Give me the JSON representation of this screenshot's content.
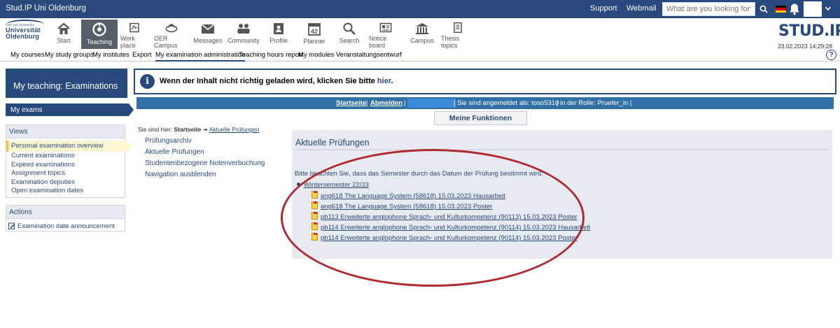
{
  "topbar": {
    "brand": "Stud.IP Uni Oldenburg",
    "support": "Support",
    "webmail": "Webmail",
    "search_placeholder": "What are you looking for?"
  },
  "logo": {
    "line1": "Carl von Ossietzky",
    "line2": "Universität",
    "line3": "Oldenburg"
  },
  "nav": {
    "items": [
      {
        "label": "Start",
        "icon": "house-icon"
      },
      {
        "label": "Teaching",
        "icon": "teaching-icon"
      },
      {
        "label": "Work place",
        "icon": "workplace-icon"
      },
      {
        "label": "OER Campus",
        "icon": "oer-icon"
      },
      {
        "label": "Messages",
        "icon": "mail-icon"
      },
      {
        "label": "Community",
        "icon": "community-icon"
      },
      {
        "label": "Profile",
        "icon": "profile-icon"
      },
      {
        "label": "Planner",
        "icon": "calendar-icon"
      },
      {
        "label": "Search",
        "icon": "search-icon"
      },
      {
        "label": "Notice board",
        "icon": "notice-board-icon"
      },
      {
        "label": "Campus",
        "icon": "campus-icon"
      },
      {
        "label": "Thesis topics",
        "icon": "thesis-icon"
      }
    ],
    "calendar_day": "42"
  },
  "studip_brand": "STUD.IP",
  "datetime": "23.02.2023 14:29:28",
  "subnav": {
    "items": [
      "My courses",
      "My study groups",
      "My institutes",
      "Export",
      "My examination administration",
      "Teaching hours report",
      "My modules",
      "Veranstaltungsentwurf"
    ],
    "active": "My examination administration",
    "help": "?"
  },
  "sidebar": {
    "title": "My teaching: Examinations",
    "current": "My exams",
    "views_title": "Views",
    "views": [
      "Personal examination overview",
      "Current examinations",
      "Expired examinations",
      "Assignment topics",
      "Examination deputies",
      "Open examination dates"
    ],
    "actions_title": "Actions",
    "actions": [
      "Examination date announcement"
    ]
  },
  "info": {
    "message": "Wenn der Inhalt nicht richtig geladen wird, klicken Sie bitte",
    "link": "hier",
    "end": "."
  },
  "bluebar": {
    "startseite": "Startseite",
    "abmelden": "Abmelden",
    "login_text": "| Sie sind angemeldet als: toso5310",
    "role_text": "| in der Rolle: Pruefer_in |",
    "sep": "|"
  },
  "functions_button": "Meine Funktionen",
  "breadcrumb": {
    "prefix": "Sie sind hier:",
    "home": "Startseite",
    "current": "Aktuelle Prüfungen"
  },
  "leftnav": [
    "Prüfungsarchiv",
    "Aktuelle Prüfungen",
    "Studentenbezogene Notenverbuchung",
    "Navigation ausblenden"
  ],
  "panel": {
    "title": "Aktuelle Prüfungen",
    "intro": "Bitte beachten Sie, dass das Semester durch das Datum der Prüfung bestimmt wird:",
    "semester": "Wintersemester 22/23",
    "exams": [
      "ang618 The Language System (58618) 15.03.2023 Hausarbeit",
      "ang618 The Language System (58618) 15.03.2023 Poster",
      "pb113 Erweiterte anglophone Sprach- und Kulturkompetenz (90113) 15.03.2023 Poster",
      "pb114 Erweiterte anglophone Sprach- und Kulturkompetenz (90114) 15.03.2023 Hausarbeit",
      "pb114 Erweiterte anglophone Sprach- und Kulturkompetenz (90114) 15.03.2023 Poster"
    ]
  },
  "colors": {
    "primary": "#28497c",
    "bluebar": "#3470a8",
    "panel": "#e7ebf1",
    "highlight_ellipse": "#b02a30",
    "active_view": "#fff7d2"
  }
}
